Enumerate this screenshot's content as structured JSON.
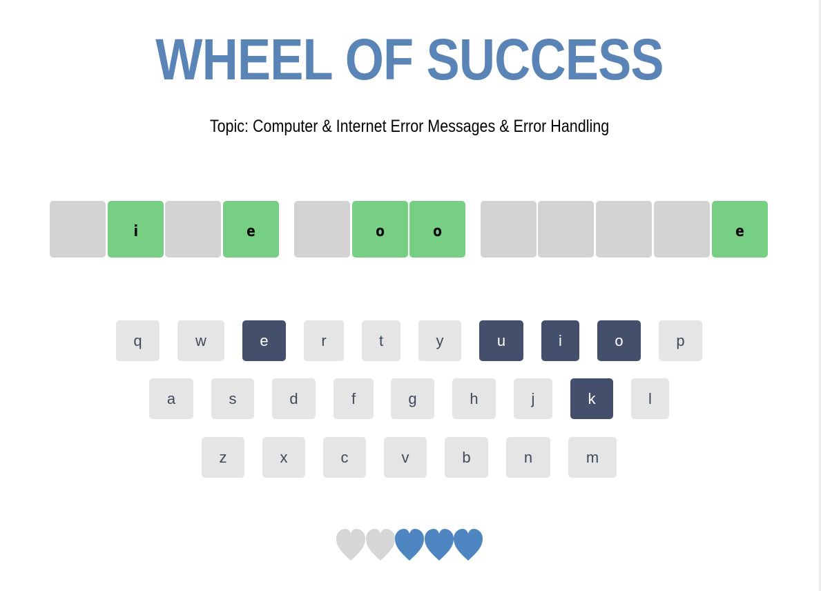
{
  "title": "WHEEL OF SUCCESS",
  "topic": "Topic: Computer & Internet Error Messages & Error Handling",
  "puzzle": {
    "tiles": [
      {
        "letter": "",
        "revealed": false
      },
      {
        "letter": "i",
        "revealed": true
      },
      {
        "letter": "",
        "revealed": false
      },
      {
        "letter": "e",
        "revealed": true
      },
      {
        "letter": "",
        "revealed": false
      },
      {
        "letter": "o",
        "revealed": true
      },
      {
        "letter": "o",
        "revealed": true
      },
      {
        "letter": "",
        "revealed": false
      },
      {
        "letter": "",
        "revealed": false
      },
      {
        "letter": "",
        "revealed": false
      },
      {
        "letter": "",
        "revealed": false
      },
      {
        "letter": "e",
        "revealed": true
      }
    ]
  },
  "keyboard": {
    "rows": [
      [
        {
          "label": "q",
          "used": false
        },
        {
          "label": "w",
          "used": false
        },
        {
          "label": "e",
          "used": true
        },
        {
          "label": "r",
          "used": false
        },
        {
          "label": "t",
          "used": false
        },
        {
          "label": "y",
          "used": false
        },
        {
          "label": "u",
          "used": true
        },
        {
          "label": "i",
          "used": true
        },
        {
          "label": "o",
          "used": true
        },
        {
          "label": "p",
          "used": false
        }
      ],
      [
        {
          "label": "a",
          "used": false
        },
        {
          "label": "s",
          "used": false
        },
        {
          "label": "d",
          "used": false
        },
        {
          "label": "f",
          "used": false
        },
        {
          "label": "g",
          "used": false
        },
        {
          "label": "h",
          "used": false
        },
        {
          "label": "j",
          "used": false
        },
        {
          "label": "k",
          "used": true
        },
        {
          "label": "l",
          "used": false
        }
      ],
      [
        {
          "label": "z",
          "used": false
        },
        {
          "label": "x",
          "used": false
        },
        {
          "label": "c",
          "used": false
        },
        {
          "label": "v",
          "used": false
        },
        {
          "label": "b",
          "used": false
        },
        {
          "label": "n",
          "used": false
        },
        {
          "label": "m",
          "used": false
        }
      ]
    ]
  },
  "lives": {
    "total": 5,
    "lost": 2,
    "remaining": 3,
    "icon": "heart-icon",
    "colors": {
      "lost": "#d6d6d6",
      "remaining": "#4e86c1"
    }
  },
  "colors": {
    "title": "#5b84b6",
    "tile_hidden": "#d3d3d3",
    "tile_revealed": "#77cf84",
    "key_default": "#e5e5e5",
    "key_used": "#434f6b"
  }
}
